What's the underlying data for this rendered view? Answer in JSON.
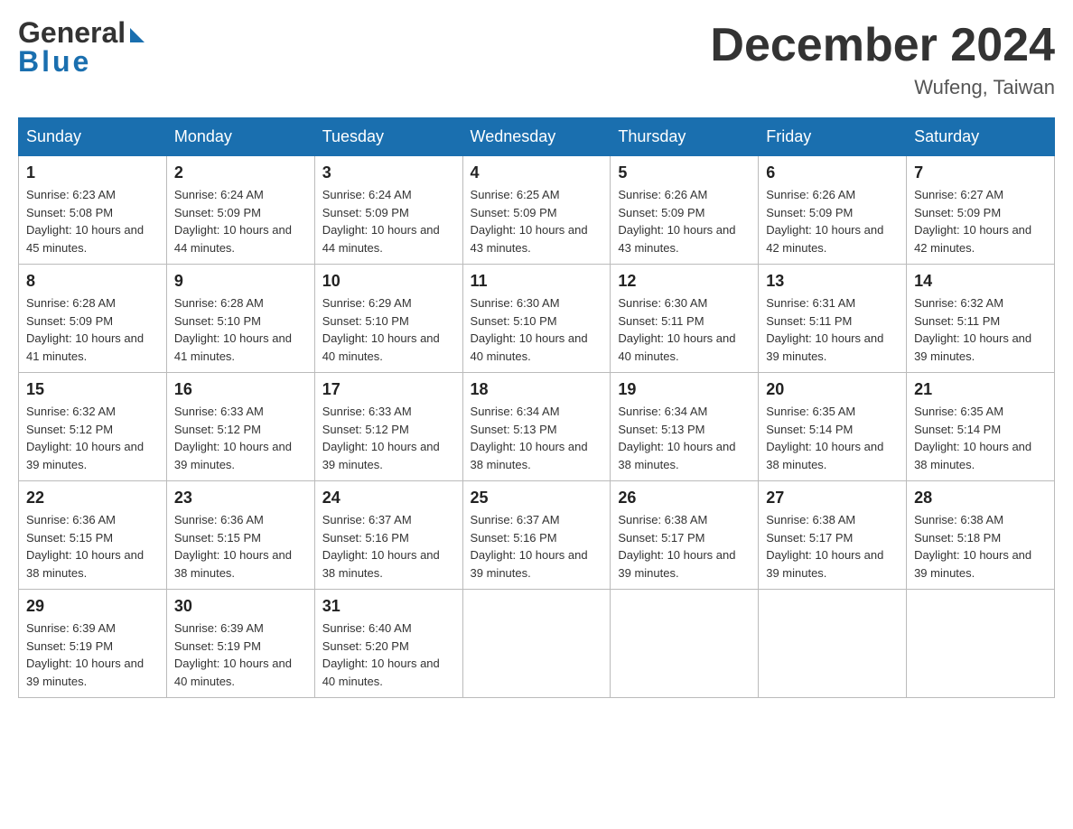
{
  "header": {
    "logo_general": "General",
    "logo_blue": "Blue",
    "title": "December 2024",
    "location": "Wufeng, Taiwan"
  },
  "calendar": {
    "days": [
      "Sunday",
      "Monday",
      "Tuesday",
      "Wednesday",
      "Thursday",
      "Friday",
      "Saturday"
    ],
    "weeks": [
      [
        {
          "num": "1",
          "sunrise": "6:23 AM",
          "sunset": "5:08 PM",
          "daylight": "10 hours and 45 minutes."
        },
        {
          "num": "2",
          "sunrise": "6:24 AM",
          "sunset": "5:09 PM",
          "daylight": "10 hours and 44 minutes."
        },
        {
          "num": "3",
          "sunrise": "6:24 AM",
          "sunset": "5:09 PM",
          "daylight": "10 hours and 44 minutes."
        },
        {
          "num": "4",
          "sunrise": "6:25 AM",
          "sunset": "5:09 PM",
          "daylight": "10 hours and 43 minutes."
        },
        {
          "num": "5",
          "sunrise": "6:26 AM",
          "sunset": "5:09 PM",
          "daylight": "10 hours and 43 minutes."
        },
        {
          "num": "6",
          "sunrise": "6:26 AM",
          "sunset": "5:09 PM",
          "daylight": "10 hours and 42 minutes."
        },
        {
          "num": "7",
          "sunrise": "6:27 AM",
          "sunset": "5:09 PM",
          "daylight": "10 hours and 42 minutes."
        }
      ],
      [
        {
          "num": "8",
          "sunrise": "6:28 AM",
          "sunset": "5:09 PM",
          "daylight": "10 hours and 41 minutes."
        },
        {
          "num": "9",
          "sunrise": "6:28 AM",
          "sunset": "5:10 PM",
          "daylight": "10 hours and 41 minutes."
        },
        {
          "num": "10",
          "sunrise": "6:29 AM",
          "sunset": "5:10 PM",
          "daylight": "10 hours and 40 minutes."
        },
        {
          "num": "11",
          "sunrise": "6:30 AM",
          "sunset": "5:10 PM",
          "daylight": "10 hours and 40 minutes."
        },
        {
          "num": "12",
          "sunrise": "6:30 AM",
          "sunset": "5:11 PM",
          "daylight": "10 hours and 40 minutes."
        },
        {
          "num": "13",
          "sunrise": "6:31 AM",
          "sunset": "5:11 PM",
          "daylight": "10 hours and 39 minutes."
        },
        {
          "num": "14",
          "sunrise": "6:32 AM",
          "sunset": "5:11 PM",
          "daylight": "10 hours and 39 minutes."
        }
      ],
      [
        {
          "num": "15",
          "sunrise": "6:32 AM",
          "sunset": "5:12 PM",
          "daylight": "10 hours and 39 minutes."
        },
        {
          "num": "16",
          "sunrise": "6:33 AM",
          "sunset": "5:12 PM",
          "daylight": "10 hours and 39 minutes."
        },
        {
          "num": "17",
          "sunrise": "6:33 AM",
          "sunset": "5:12 PM",
          "daylight": "10 hours and 39 minutes."
        },
        {
          "num": "18",
          "sunrise": "6:34 AM",
          "sunset": "5:13 PM",
          "daylight": "10 hours and 38 minutes."
        },
        {
          "num": "19",
          "sunrise": "6:34 AM",
          "sunset": "5:13 PM",
          "daylight": "10 hours and 38 minutes."
        },
        {
          "num": "20",
          "sunrise": "6:35 AM",
          "sunset": "5:14 PM",
          "daylight": "10 hours and 38 minutes."
        },
        {
          "num": "21",
          "sunrise": "6:35 AM",
          "sunset": "5:14 PM",
          "daylight": "10 hours and 38 minutes."
        }
      ],
      [
        {
          "num": "22",
          "sunrise": "6:36 AM",
          "sunset": "5:15 PM",
          "daylight": "10 hours and 38 minutes."
        },
        {
          "num": "23",
          "sunrise": "6:36 AM",
          "sunset": "5:15 PM",
          "daylight": "10 hours and 38 minutes."
        },
        {
          "num": "24",
          "sunrise": "6:37 AM",
          "sunset": "5:16 PM",
          "daylight": "10 hours and 38 minutes."
        },
        {
          "num": "25",
          "sunrise": "6:37 AM",
          "sunset": "5:16 PM",
          "daylight": "10 hours and 39 minutes."
        },
        {
          "num": "26",
          "sunrise": "6:38 AM",
          "sunset": "5:17 PM",
          "daylight": "10 hours and 39 minutes."
        },
        {
          "num": "27",
          "sunrise": "6:38 AM",
          "sunset": "5:17 PM",
          "daylight": "10 hours and 39 minutes."
        },
        {
          "num": "28",
          "sunrise": "6:38 AM",
          "sunset": "5:18 PM",
          "daylight": "10 hours and 39 minutes."
        }
      ],
      [
        {
          "num": "29",
          "sunrise": "6:39 AM",
          "sunset": "5:19 PM",
          "daylight": "10 hours and 39 minutes."
        },
        {
          "num": "30",
          "sunrise": "6:39 AM",
          "sunset": "5:19 PM",
          "daylight": "10 hours and 40 minutes."
        },
        {
          "num": "31",
          "sunrise": "6:40 AM",
          "sunset": "5:20 PM",
          "daylight": "10 hours and 40 minutes."
        },
        null,
        null,
        null,
        null
      ]
    ]
  }
}
